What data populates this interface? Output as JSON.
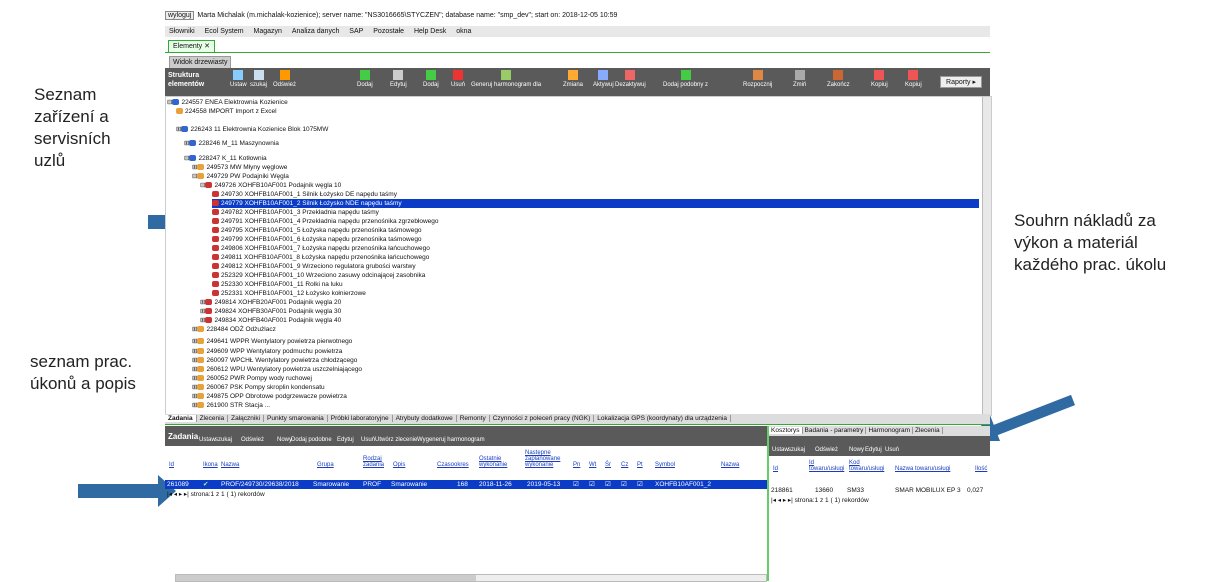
{
  "annotations": {
    "devices": "Seznam\nzařízení a\nservisních\nuzlů",
    "tasks": "seznam prac.\núkonů a popis",
    "costs": "Souhrn nákladů za\nvýkon a materiál\nkaždého prac. úkolu"
  },
  "session": {
    "logout": "wyloguj",
    "info": "Marta Michalak (m.michalak-kozienice); server name: \"NS3016665\\STYCZEN\"; database name: \"smp_dev\"; start on: 2018-12-05 10:59"
  },
  "menu": [
    "Słowniki",
    "Ecol System",
    "Magazyn",
    "Analiza danych",
    "SAP",
    "Pozostałe",
    "Help Desk",
    "okna"
  ],
  "main_tab": "Elementy",
  "sub_tab": "Widok drzewiasty",
  "toolbar": {
    "title": "Struktura elementów",
    "buttons": [
      "Ustaw",
      "szukaj",
      "Odśwież",
      "Dodaj",
      "Edytuj",
      "Dodaj",
      "Usuń",
      "Generuj harmonogram dla",
      "Zmiana",
      "Aktywuj",
      "Dezaktywuj",
      "Dodaj podobny z",
      "Rozpocznij",
      "Zmiń",
      "Zakończ",
      "Kopiuj",
      "Kopiuj"
    ],
    "reports": "Raporty"
  },
  "tree": [
    "224557 ENEA Elektrownia Kozienice",
    "224558 IMPORT Import z Excel",
    "226243 11 Elektrownia Kozienice Blok 1075MW",
    "228246 M_11 Maszynownia",
    "228247 K_11 Kotłownia",
    "249573 MW Młyny węglowe",
    "249729 PW Podajniki Węgla",
    "249726 XOHFB10AF001 Podajnik węgla 10",
    "249730 XOHFB10AF001_1 Silnik Łożysko DE napędu taśmy",
    "249779 XOHFB10AF001_2 Silnik Łożysko NDE napędu taśmy",
    "249782 XOHFB10AF001_3 Przekładnia napędu taśmy",
    "249791 XOHFB10AF001_4 Przekładnia napędu przenośnika zgrzebłowego",
    "249795 XOHFB10AF001_5 Łożyska napędu przenośnika taśmowego",
    "249799 XOHFB10AF001_6 Łożyska napędu przenośnika taśmowego",
    "249806 XOHFB10AF001_7 Łożyska napędu przenośnika łańcuchowego",
    "249811 XOHFB10AF001_8 Łożyska napędu przenośnika łańcuchowego",
    "249812 XOHFB10AF001_9 Wrzeciono regulatora grubości warstwy",
    "252329 XOHFB10AF001_10 Wrzeciono zasuwy odcinającej zasobnika",
    "252330 XOHFB10AF001_11 Rolki na luku",
    "252331 XOHFB10AF001_12 Łożysko kołnierzowe",
    "249814 XOHFB20AF001 Podajnik węgla 20",
    "249824 XOHFB30AF001 Podajnik węgla 30",
    "249834 XOHFB40AF001 Podajnik węgla 40",
    "228484 ODŻ Odżużlacz",
    "249641 WPPR Wentylatory powietrza pierwotnego",
    "249609 WPP Wentylatory podmuchu powietrza",
    "260097 WPCHŁ Wentylatory powietrza chłodzącego",
    "260612 WPU Wentylatory powietrza uszczelniającego",
    "260052 PWR Pompy wody ruchowej",
    "260067 PSK Pompy skroplin kondensatu",
    "249875 OPP Obrotowe podgrzewacze powietrza",
    "261900 STR Stacja ..."
  ],
  "bottom_tabs": [
    "Zadania",
    "Zlecenia",
    "Załączniki",
    "Punkty smarowania",
    "Próbki laboratoryjne",
    "Atrybuty dodatkowe",
    "Remonty",
    "Czynności z poleceń pracy (NGK)",
    "Lokalizacja GPS (koordynaty) dla urządzenia"
  ],
  "left_panel": {
    "title": "Zadania",
    "buttons": [
      "Ustaw",
      "szukaj",
      "Odśwież",
      "Nowy",
      "Dodaj podobne",
      "Edytuj",
      "Usuń",
      "Utwórz zlecenie",
      "Wygeneruj harmonogram"
    ],
    "headers": [
      "Id",
      "Ikona",
      "Nazwa",
      "Grupa",
      "Rodzaj zadania",
      "Opis",
      "Czasookres",
      "Ostatnie wykonanie",
      "Następne zaplanowane wykonanie",
      "Pn",
      "Wt",
      "Śr",
      "Cz",
      "Pt",
      "Symbol",
      "Nazwa"
    ],
    "row": {
      "id": "261089",
      "name": "PROF/249730/29638/2018",
      "group": "Smarowanie",
      "kind": "PROF",
      "desc": "Smarowanie",
      "period": "168",
      "last": "2018-11-26",
      "next": "2019-05-13",
      "symbol": "XOHFB10AF001_2"
    },
    "pager": "strona:1 z 1 ( 1) rekordów"
  },
  "right_panel": {
    "tabs": [
      "Kosztorys",
      "Badania - parametry",
      "Harmonogram",
      "Zlecenia"
    ],
    "buttons": [
      "Ustaw",
      "szukaj",
      "Odśwież",
      "Nowy",
      "Edytuj",
      "Usuń"
    ],
    "headers": [
      "Id",
      "Id towaru/usługi",
      "Kod towaru/usługi",
      "Nazwa towaru/usługi",
      "Ilość"
    ],
    "row": {
      "id": "218861",
      "item_id": "13660",
      "code": "SM33",
      "name": "SMAR MOBILUX EP 3",
      "qty": "0,027"
    },
    "pager": "strona:1 z 1 ( 1) rekordów"
  },
  "colors": {
    "selection": "#0a3cc8",
    "toolbar": "#5a5a5a",
    "arrow": "#2f6aa3",
    "divider": "#66cc66"
  }
}
